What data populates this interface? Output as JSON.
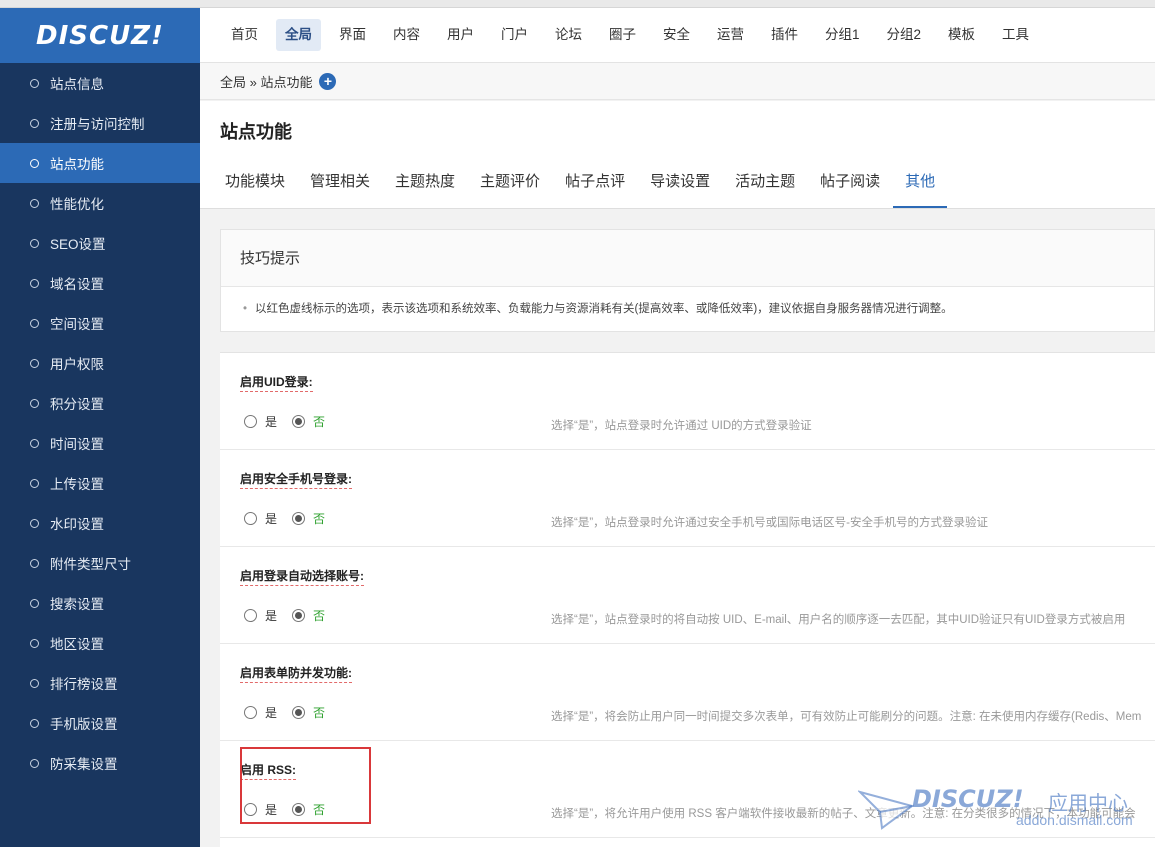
{
  "brand": {
    "logo_text": "DISCUZ!"
  },
  "sidebar": {
    "items": [
      {
        "label": "站点信息",
        "active": false
      },
      {
        "label": "注册与访问控制",
        "active": false
      },
      {
        "label": "站点功能",
        "active": true
      },
      {
        "label": "性能优化",
        "active": false
      },
      {
        "label": "SEO设置",
        "active": false
      },
      {
        "label": "域名设置",
        "active": false
      },
      {
        "label": "空间设置",
        "active": false
      },
      {
        "label": "用户权限",
        "active": false
      },
      {
        "label": "积分设置",
        "active": false
      },
      {
        "label": "时间设置",
        "active": false
      },
      {
        "label": "上传设置",
        "active": false
      },
      {
        "label": "水印设置",
        "active": false
      },
      {
        "label": "附件类型尺寸",
        "active": false
      },
      {
        "label": "搜索设置",
        "active": false
      },
      {
        "label": "地区设置",
        "active": false
      },
      {
        "label": "排行榜设置",
        "active": false
      },
      {
        "label": "手机版设置",
        "active": false
      },
      {
        "label": "防采集设置",
        "active": false
      }
    ]
  },
  "topnav": {
    "items": [
      {
        "label": "首页",
        "active": false
      },
      {
        "label": "全局",
        "active": true
      },
      {
        "label": "界面",
        "active": false
      },
      {
        "label": "内容",
        "active": false
      },
      {
        "label": "用户",
        "active": false
      },
      {
        "label": "门户",
        "active": false
      },
      {
        "label": "论坛",
        "active": false
      },
      {
        "label": "圈子",
        "active": false
      },
      {
        "label": "安全",
        "active": false
      },
      {
        "label": "运营",
        "active": false
      },
      {
        "label": "插件",
        "active": false
      },
      {
        "label": "分组1",
        "active": false
      },
      {
        "label": "分组2",
        "active": false
      },
      {
        "label": "模板",
        "active": false
      },
      {
        "label": "工具",
        "active": false
      }
    ]
  },
  "breadcrumb": {
    "text": "全局 » 站点功能",
    "add_icon": "plus-circle-icon"
  },
  "page": {
    "title": "站点功能",
    "tabs": [
      {
        "label": "功能模块",
        "active": false
      },
      {
        "label": "管理相关",
        "active": false
      },
      {
        "label": "主题热度",
        "active": false
      },
      {
        "label": "主题评价",
        "active": false
      },
      {
        "label": "帖子点评",
        "active": false
      },
      {
        "label": "导读设置",
        "active": false
      },
      {
        "label": "活动主题",
        "active": false
      },
      {
        "label": "帖子阅读",
        "active": false
      },
      {
        "label": "其他",
        "active": true
      }
    ]
  },
  "tips": {
    "title": "技巧提示",
    "text": "以红色虚线标示的选项，表示该选项和系统效率、负载能力与资源消耗有关(提高效率、或降低效率)，建议依据自身服务器情况进行调整。"
  },
  "settings": [
    {
      "label": "启用UID登录:",
      "yes": "是",
      "no": "否",
      "selected": "no",
      "desc": "选择“是”，站点登录时允许通过 UID的方式登录验证"
    },
    {
      "label": "启用安全手机号登录:",
      "yes": "是",
      "no": "否",
      "selected": "no",
      "desc": "选择“是”，站点登录时允许通过安全手机号或国际电话区号-安全手机号的方式登录验证"
    },
    {
      "label": "启用登录自动选择账号:",
      "yes": "是",
      "no": "否",
      "selected": "no",
      "desc": "选择“是”，站点登录时的将自动按 UID、E-mail、用户名的顺序逐一去匹配，其中UID验证只有UID登录方式被启用"
    },
    {
      "label": "启用表单防并发功能:",
      "yes": "是",
      "no": "否",
      "selected": "no",
      "desc": "选择“是”，将会防止用户同一时间提交多次表单，可有效防止可能刷分的问题。注意: 在未使用内存缓存(Redis、Mem"
    },
    {
      "label": "启用 RSS:",
      "yes": "是",
      "no": "否",
      "selected": "no",
      "desc": "选择“是”，将允许用户使用 RSS 客户端软件接收最新的帖子、文章更新。注意: 在分类很多的情况下，本功能可能会"
    }
  ],
  "watermark": {
    "logo": "DISCUZ!",
    "cn": "应用中心",
    "url": "addon.dismall.com"
  },
  "colors": {
    "sidebar_bg": "#19365f",
    "accent": "#2c6ab6",
    "highlight_border": "#d9383a",
    "option_no": "#2ca02c"
  }
}
